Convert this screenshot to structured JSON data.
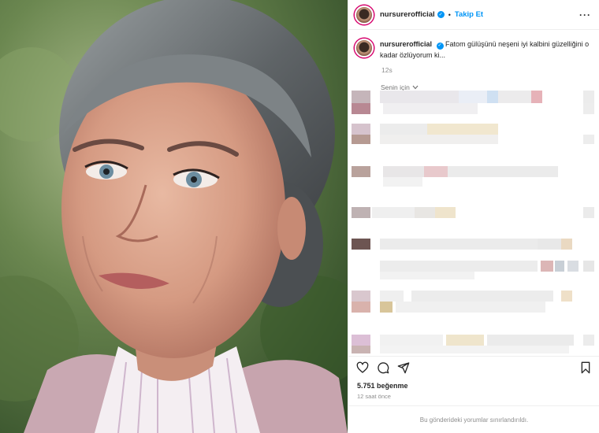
{
  "post": {
    "username": "nursurerofficial",
    "separator": "•",
    "follow_label": "Takip Et",
    "more_label": "···",
    "caption_text": "Fatom gülüşünü neşeni iyi kalbini güzelliğini o kadar özlüyorum ki...",
    "caption_time": "12s",
    "comments_filter": "Senin için",
    "likes_text": "5.751 beğenme",
    "posted_ago": "12 saat önce",
    "comments_limited_text": "Bu gönderideki yorumlar sınırlandırıldı."
  },
  "icons": {
    "verified": "verified-badge-icon",
    "like": "heart-icon",
    "comment": "comment-icon",
    "share": "share-icon",
    "save": "bookmark-icon",
    "filter": "chevron-down-icon"
  },
  "colors": {
    "link_blue": "#0095f6",
    "text": "#262626",
    "muted": "#8e8e8e",
    "border": "#efefef"
  }
}
